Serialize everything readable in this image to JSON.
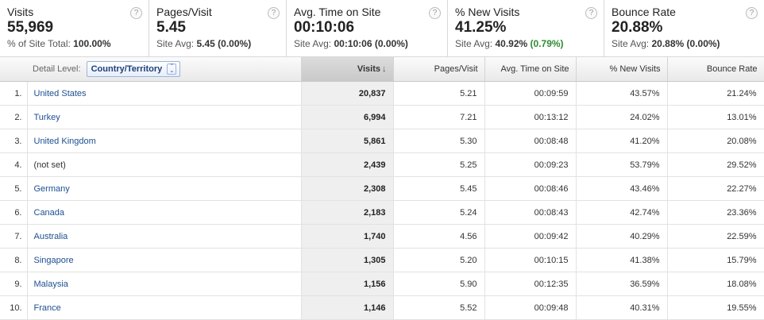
{
  "summary": [
    {
      "title": "Visits",
      "value": "55,969",
      "sub_label": "% of Site Total: ",
      "sub_value": "100.00%",
      "sub_extra": ""
    },
    {
      "title": "Pages/Visit",
      "value": "5.45",
      "sub_label": "Site Avg: ",
      "sub_value": "5.45 (0.00%)",
      "sub_extra": ""
    },
    {
      "title": "Avg. Time on Site",
      "value": "00:10:06",
      "sub_label": "Site Avg: ",
      "sub_value": "00:10:06 (0.00%)",
      "sub_extra": ""
    },
    {
      "title": "% New Visits",
      "value": "41.25%",
      "sub_label": "Site Avg: ",
      "sub_value": "40.92%",
      "sub_extra": "(0.79%)"
    },
    {
      "title": "Bounce Rate",
      "value": "20.88%",
      "sub_label": "Site Avg: ",
      "sub_value": "20.88% (0.00%)",
      "sub_extra": ""
    }
  ],
  "help_glyph": "?",
  "table": {
    "detail_level_label": "Detail Level:",
    "detail_level_value": "Country/Territory",
    "columns": [
      "Visits",
      "Pages/Visit",
      "Avg. Time on Site",
      "% New Visits",
      "Bounce Rate"
    ],
    "sort_arrow": "↓",
    "rows": [
      {
        "n": "1.",
        "country": "United States",
        "link": true,
        "visits": "20,837",
        "ppv": "5.21",
        "time": "00:09:59",
        "new": "43.57%",
        "bounce": "21.24%"
      },
      {
        "n": "2.",
        "country": "Turkey",
        "link": true,
        "visits": "6,994",
        "ppv": "7.21",
        "time": "00:13:12",
        "new": "24.02%",
        "bounce": "13.01%"
      },
      {
        "n": "3.",
        "country": "United Kingdom",
        "link": true,
        "visits": "5,861",
        "ppv": "5.30",
        "time": "00:08:48",
        "new": "41.20%",
        "bounce": "20.08%"
      },
      {
        "n": "4.",
        "country": "(not set)",
        "link": false,
        "visits": "2,439",
        "ppv": "5.25",
        "time": "00:09:23",
        "new": "53.79%",
        "bounce": "29.52%"
      },
      {
        "n": "5.",
        "country": "Germany",
        "link": true,
        "visits": "2,308",
        "ppv": "5.45",
        "time": "00:08:46",
        "new": "43.46%",
        "bounce": "22.27%"
      },
      {
        "n": "6.",
        "country": "Canada",
        "link": true,
        "visits": "2,183",
        "ppv": "5.24",
        "time": "00:08:43",
        "new": "42.74%",
        "bounce": "23.36%"
      },
      {
        "n": "7.",
        "country": "Australia",
        "link": true,
        "visits": "1,740",
        "ppv": "4.56",
        "time": "00:09:42",
        "new": "40.29%",
        "bounce": "22.59%"
      },
      {
        "n": "8.",
        "country": "Singapore",
        "link": true,
        "visits": "1,305",
        "ppv": "5.20",
        "time": "00:10:15",
        "new": "41.38%",
        "bounce": "15.79%"
      },
      {
        "n": "9.",
        "country": "Malaysia",
        "link": true,
        "visits": "1,156",
        "ppv": "5.90",
        "time": "00:12:35",
        "new": "36.59%",
        "bounce": "18.08%"
      },
      {
        "n": "10.",
        "country": "France",
        "link": true,
        "visits": "1,146",
        "ppv": "5.52",
        "time": "00:09:48",
        "new": "40.31%",
        "bounce": "19.55%"
      }
    ]
  },
  "colors": {
    "link": "#1d4f91",
    "positive": "#2e8b2e",
    "visits_column_bg": "#efefef"
  }
}
